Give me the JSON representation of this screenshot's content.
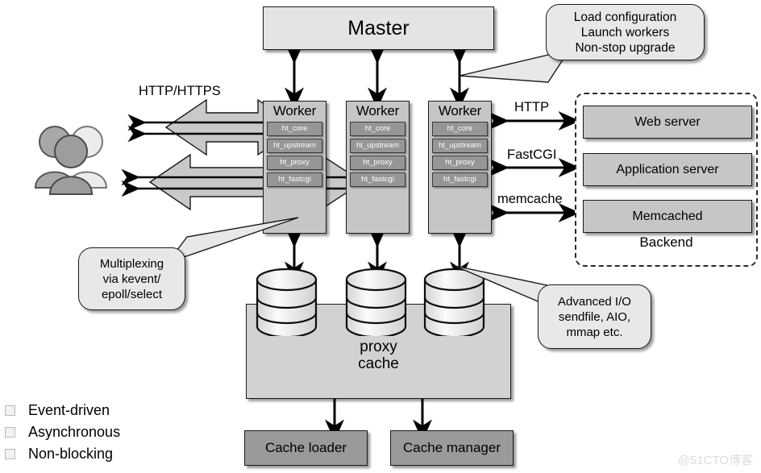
{
  "diagram": {
    "title": "nginx architecture diagram",
    "master": {
      "label": "Master"
    },
    "master_callout": {
      "lines": [
        "Load configuration",
        "Launch workers",
        "Non-stop upgrade"
      ]
    },
    "workers": [
      {
        "title": "Worker",
        "modules": [
          "ht_core",
          "ht_upstream",
          "ht_proxy",
          "ht_fastcgi"
        ]
      },
      {
        "title": "Worker",
        "modules": [
          "ht_core",
          "ht_upstream",
          "ht_proxy",
          "ht_fastcgi"
        ]
      },
      {
        "title": "Worker",
        "modules": [
          "ht_core",
          "ht_upstream",
          "ht_proxy",
          "ht_fastcgi"
        ]
      }
    ],
    "client_link_label": "HTTP/HTTPS",
    "client_icon": "users-group-icon",
    "backend": {
      "group_label": "Backend",
      "items": [
        {
          "label": "Web server",
          "protocol": "HTTP"
        },
        {
          "label": "Application server",
          "protocol": "FastCGI"
        },
        {
          "label": "Memcached",
          "protocol": "memcache"
        }
      ]
    },
    "mux_callout": {
      "lines": [
        "Multiplexing",
        "via kevent/",
        "epoll/select"
      ]
    },
    "io_callout": {
      "lines": [
        "Advanced I/O",
        "sendfile, AIO,",
        "mmap etc."
      ]
    },
    "proxy_cache": {
      "line1": "proxy",
      "line2": "cache"
    },
    "cache_loader": {
      "label": "Cache loader"
    },
    "cache_manager": {
      "label": "Cache manager"
    },
    "features": [
      "Event-driven",
      "Asynchronous",
      "Non-blocking"
    ],
    "watermark": "@51CTO博客",
    "colors": {
      "box_light": "#e4e4e4",
      "box_mid": "#c6c6c6",
      "box_dark": "#9a9a9a",
      "module": "#969696",
      "outline": "#1a1a1a",
      "arrow_fill": "#c9c9c9"
    }
  }
}
